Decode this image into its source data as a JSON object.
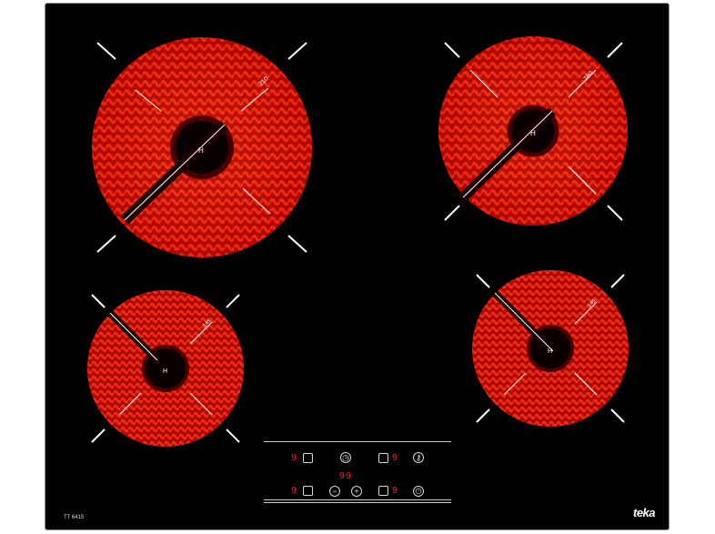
{
  "zones": [
    {
      "id": "rear-left",
      "marking": "210",
      "center_label": "H"
    },
    {
      "id": "rear-right",
      "marking": "180",
      "center_label": "H"
    },
    {
      "id": "front-left",
      "marking": "145",
      "center_label": "H"
    },
    {
      "id": "front-right",
      "marking": "145",
      "center_label": "H"
    }
  ],
  "control_panel": {
    "zone_rl_display": "9",
    "zone_rr_display": "9",
    "zone_fl_display": "9",
    "zone_fr_display": "9",
    "timer_display": "99",
    "minus_symbol": "−",
    "plus_symbol": "+"
  },
  "model_label": "TT 6415",
  "brand": "teka",
  "colors": {
    "glow": "#ff2a1a",
    "dark_ring": "#7a0000",
    "glass": "#000000"
  }
}
